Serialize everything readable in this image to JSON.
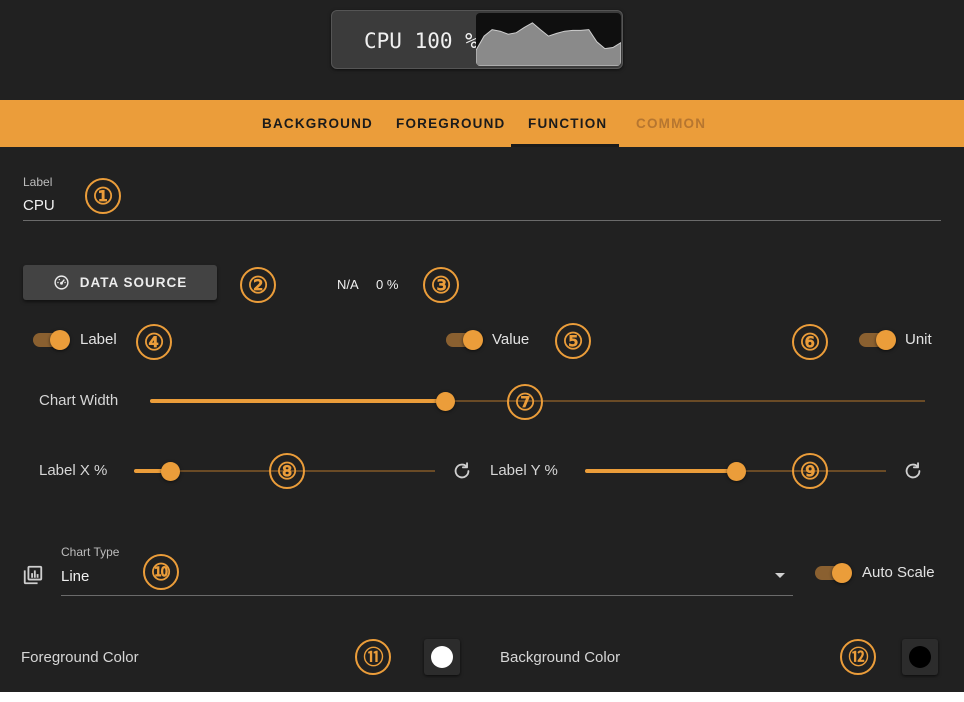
{
  "preview": {
    "text": "CPU 100 %",
    "sparkline": [
      0.18,
      0.55,
      0.72,
      0.68,
      0.6,
      0.64,
      0.78,
      0.9,
      0.72,
      0.55,
      0.62,
      0.68,
      0.7,
      0.7,
      0.72,
      0.4,
      0.22,
      0.25,
      0.38
    ]
  },
  "tabs": [
    {
      "label": "BACKGROUND",
      "state": "normal"
    },
    {
      "label": "FOREGROUND",
      "state": "normal"
    },
    {
      "label": "FUNCTION",
      "state": "active"
    },
    {
      "label": "COMMON",
      "state": "disabled"
    }
  ],
  "label_field": {
    "caption": "Label",
    "value": "CPU"
  },
  "data_source": {
    "button_label": "DATA SOURCE",
    "icon": "gauge-icon",
    "name_value": "N/A",
    "value": "0 %"
  },
  "toggles": {
    "label": {
      "text": "Label",
      "on": true
    },
    "value": {
      "text": "Value",
      "on": true
    },
    "unit": {
      "text": "Unit",
      "on": true
    },
    "auto_scale": {
      "text": "Auto Scale",
      "on": true
    }
  },
  "sliders": {
    "chart_width": {
      "label": "Chart Width",
      "fraction": 0.38
    },
    "label_x": {
      "label": "Label X %",
      "fraction": 0.12
    },
    "label_y": {
      "label": "Label Y %",
      "fraction": 0.5
    }
  },
  "chart_type": {
    "caption": "Chart Type",
    "value": "Line",
    "icon": "chart-library-icon"
  },
  "colors": {
    "foreground": {
      "label": "Foreground Color",
      "color": "#ffffff"
    },
    "background": {
      "label": "Background Color",
      "color": "#000000"
    }
  },
  "annotations": [
    "①",
    "②",
    "③",
    "④",
    "⑤",
    "⑥",
    "⑦",
    "⑧",
    "⑨",
    "⑩",
    "⑪",
    "⑫"
  ],
  "theme": {
    "accent": "#eb9d3a",
    "panel": "#212121"
  }
}
